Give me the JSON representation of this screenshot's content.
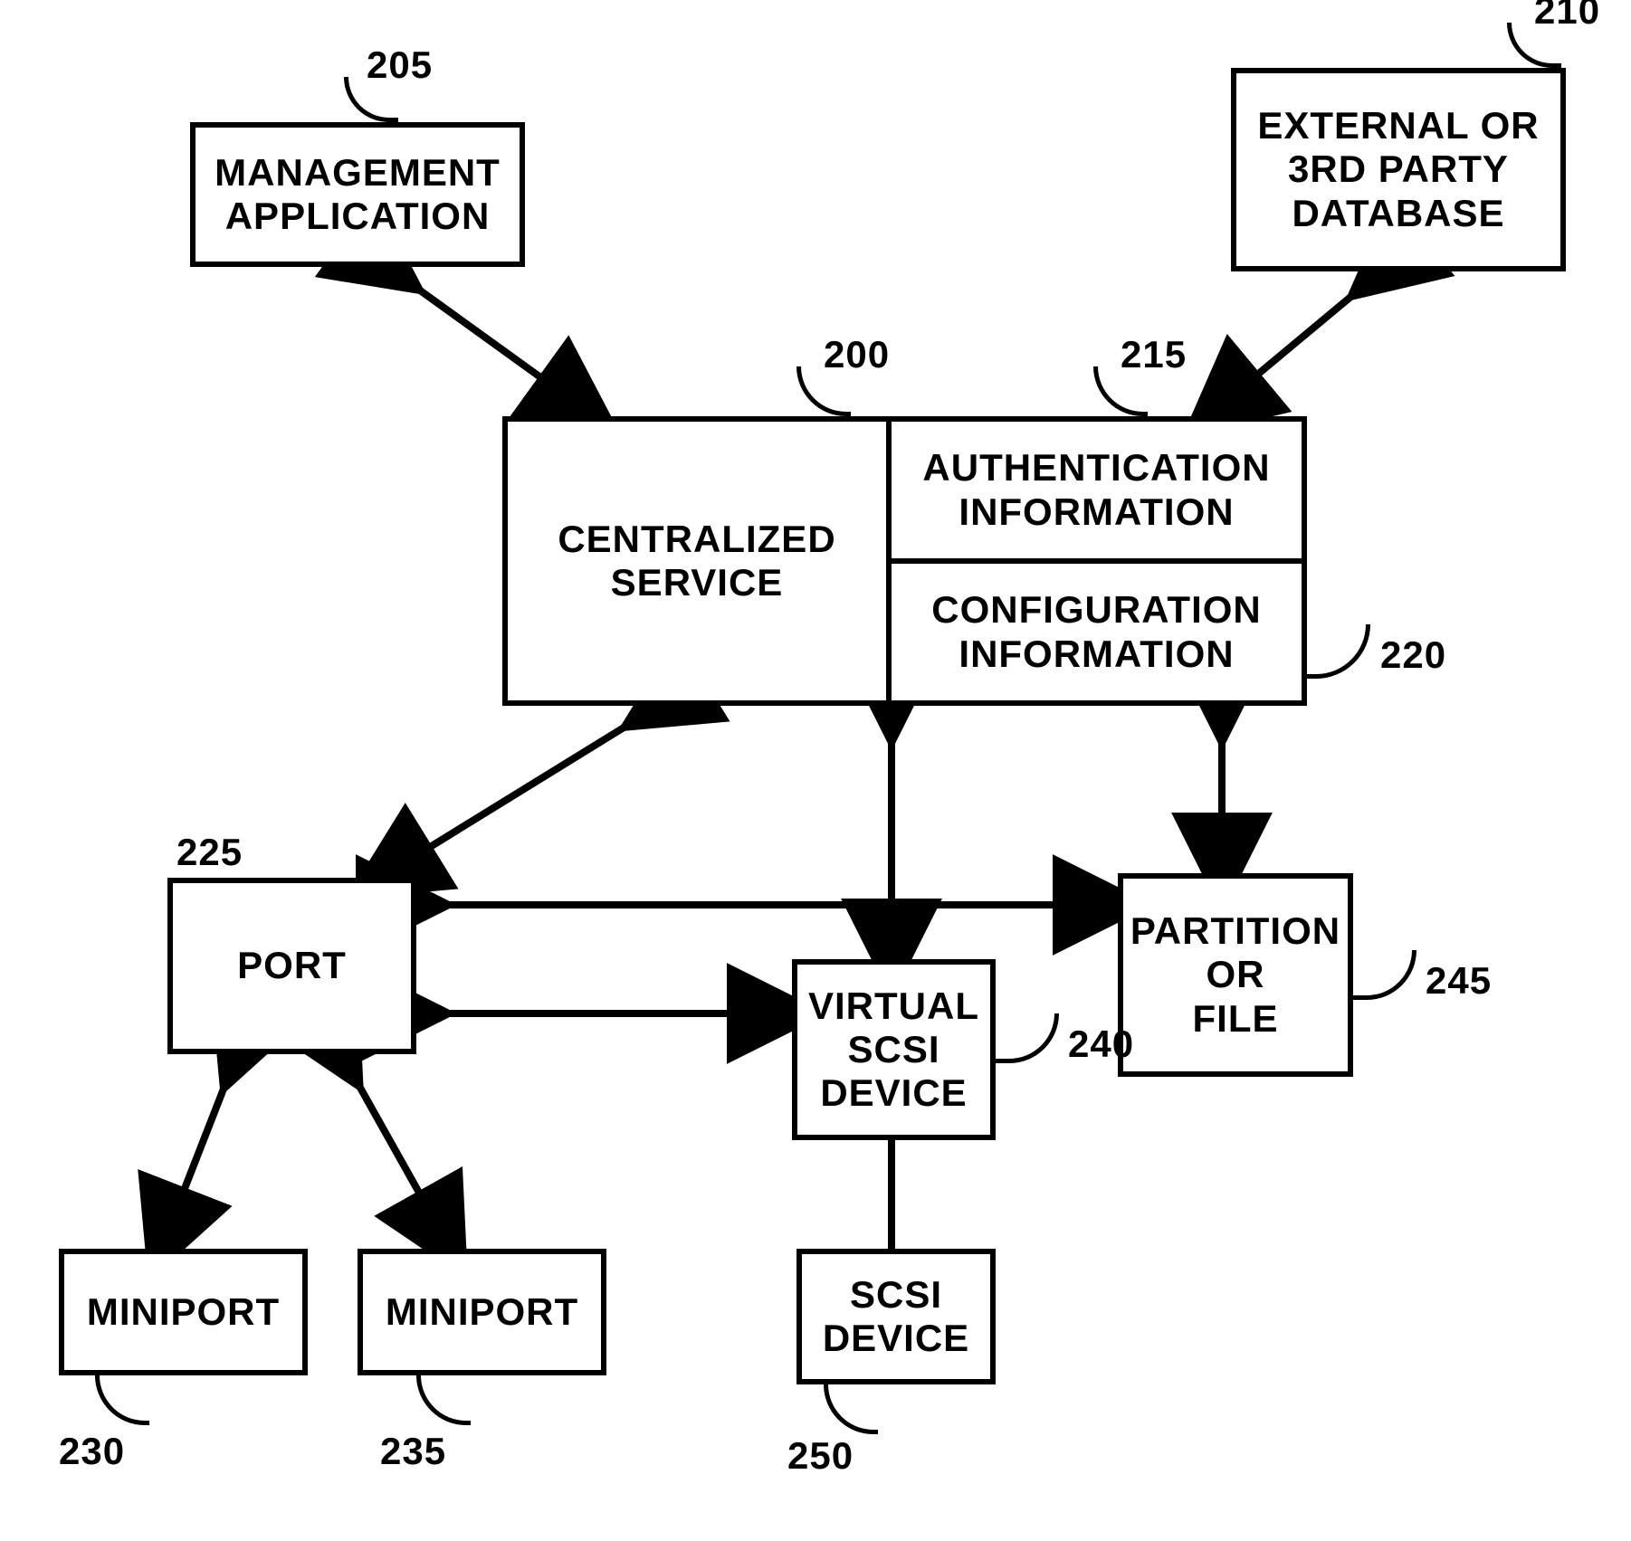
{
  "nodes": {
    "management_application": {
      "label": "MANAGEMENT\nAPPLICATION",
      "ref": "205"
    },
    "external_db": {
      "label": "EXTERNAL OR\n3RD PARTY\nDATABASE",
      "ref": "210"
    },
    "centralized_service": {
      "label": "CENTRALIZED\nSERVICE",
      "ref": "200"
    },
    "auth_info": {
      "label": "AUTHENTICATION\nINFORMATION",
      "ref": "215"
    },
    "config_info": {
      "label": "CONFIGURATION\nINFORMATION",
      "ref": "220"
    },
    "port": {
      "label": "PORT",
      "ref": "225"
    },
    "miniport_a": {
      "label": "MINIPORT",
      "ref": "230"
    },
    "miniport_b": {
      "label": "MINIPORT",
      "ref": "235"
    },
    "virtual_scsi": {
      "label": "VIRTUAL\nSCSI\nDEVICE",
      "ref": "240"
    },
    "partition_or_file": {
      "label": "PARTITION\nOR\nFILE",
      "ref": "245"
    },
    "scsi_device": {
      "label": "SCSI\nDEVICE",
      "ref": "250"
    }
  },
  "edges": [
    {
      "a": "management_application",
      "b": "centralized_service",
      "bidir": true
    },
    {
      "a": "external_db",
      "b": "centralized_service",
      "bidir": true
    },
    {
      "a": "centralized_service",
      "b": "port",
      "bidir": true
    },
    {
      "a": "centralized_service",
      "b": "virtual_scsi",
      "bidir": true
    },
    {
      "a": "centralized_service",
      "b": "partition_or_file",
      "bidir": true
    },
    {
      "a": "port",
      "b": "partition_or_file",
      "bidir": true
    },
    {
      "a": "port",
      "b": "virtual_scsi",
      "bidir": true
    },
    {
      "a": "port",
      "b": "miniport_a",
      "bidir": true
    },
    {
      "a": "port",
      "b": "miniport_b",
      "bidir": true
    },
    {
      "a": "virtual_scsi",
      "b": "scsi_device",
      "bidir": false
    }
  ]
}
